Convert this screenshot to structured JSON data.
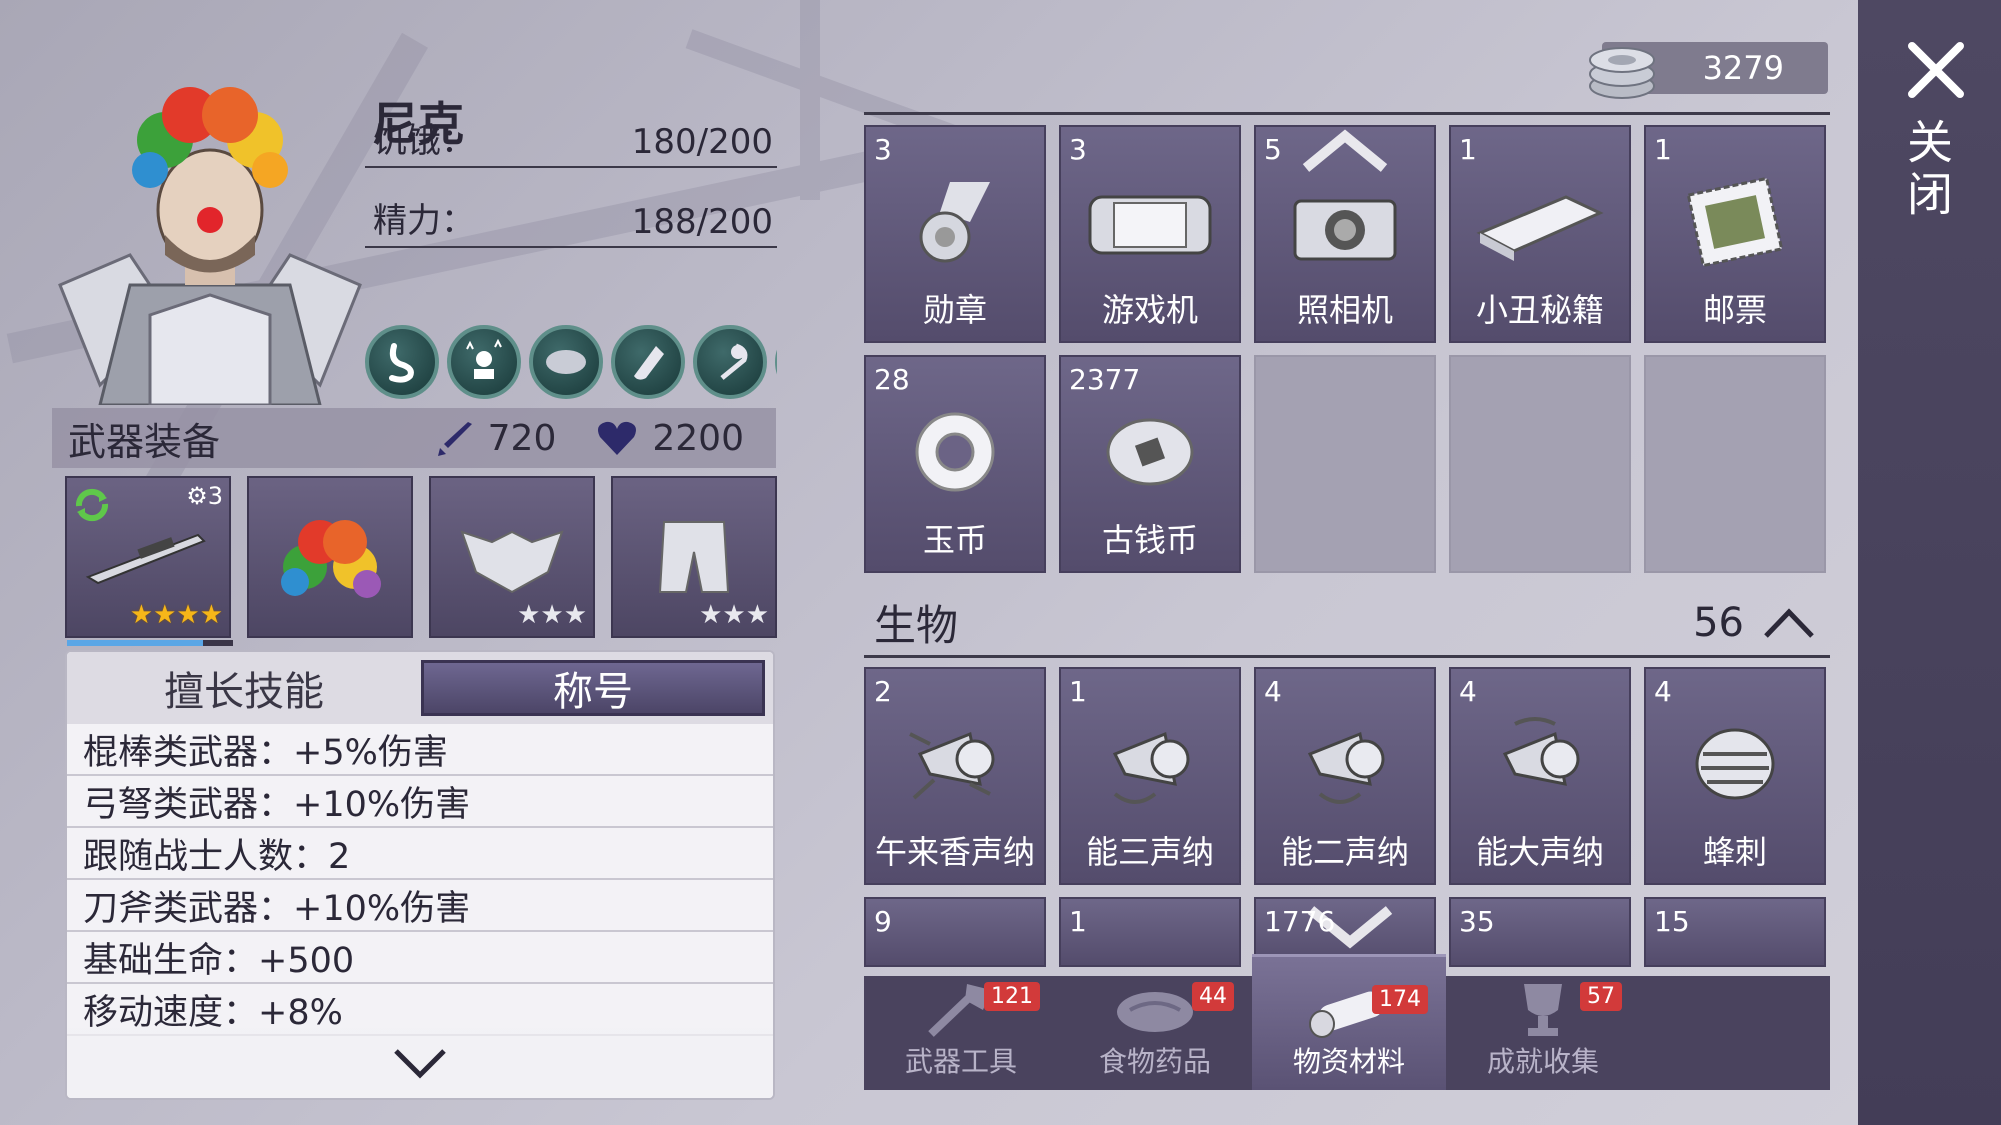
{
  "character": {
    "name": "尼克",
    "hunger_label": "饥饿：",
    "hunger_value": "180/200",
    "energy_label": "精力：",
    "energy_value": "188/200"
  },
  "equipment": {
    "title": "武器装备",
    "attack": "720",
    "health": "2200",
    "weapon_level": "3",
    "slots": [
      {
        "name": "sniper-rifle",
        "stars": 4,
        "star_type": "gold"
      },
      {
        "name": "rainbow-wig",
        "stars": 0,
        "star_type": "none"
      },
      {
        "name": "spiked-armor",
        "stars": 3,
        "star_type": "silver"
      },
      {
        "name": "armored-pants",
        "stars": 3,
        "star_type": "silver"
      }
    ],
    "weapon_xp_fraction": 0.82
  },
  "skills": {
    "tab_skills": "擅长技能",
    "tab_title": "称号",
    "rows": [
      "棍棒类武器：+5%伤害",
      "弓弩类武器：+10%伤害",
      "跟随战士人数：2",
      "刀斧类武器：+10%伤害",
      "基础生命：+500",
      "移动速度：+8%"
    ]
  },
  "currency": {
    "coins": "3279"
  },
  "inventory": {
    "top_items": [
      {
        "count": "3",
        "name": "勋章",
        "icon": "medal-icon"
      },
      {
        "count": "3",
        "name": "游戏机",
        "icon": "game-console-icon"
      },
      {
        "count": "5",
        "name": "照相机",
        "icon": "camera-icon"
      },
      {
        "count": "1",
        "name": "小丑秘籍",
        "icon": "book-icon"
      },
      {
        "count": "1",
        "name": "邮票",
        "icon": "stamp-icon"
      },
      {
        "count": "28",
        "name": "玉币",
        "icon": "jade-coin-icon"
      },
      {
        "count": "2377",
        "name": "古钱币",
        "icon": "ancient-coin-icon"
      }
    ],
    "section_title": "生物",
    "section_count": "56",
    "bio_items": [
      {
        "count": "2",
        "name": "午来香声纳",
        "icon": "sonar-icon"
      },
      {
        "count": "1",
        "name": "能三声纳",
        "icon": "sonar-icon"
      },
      {
        "count": "4",
        "name": "能二声纳",
        "icon": "sonar-icon"
      },
      {
        "count": "4",
        "name": "能大声纳",
        "icon": "sonar-icon"
      },
      {
        "count": "4",
        "name": "蜂刺",
        "icon": "bee-sting-icon"
      }
    ],
    "bio_items_row2": [
      {
        "count": "9"
      },
      {
        "count": "1"
      },
      {
        "count": "1776"
      },
      {
        "count": "35"
      },
      {
        "count": "15"
      }
    ]
  },
  "tabs": [
    {
      "label": "武器工具",
      "badge": "121",
      "icon": "axe-icon"
    },
    {
      "label": "食物药品",
      "badge": "44",
      "icon": "meat-icon"
    },
    {
      "label": "物资材料",
      "badge": "174",
      "icon": "wood-log-icon",
      "active": true
    },
    {
      "label": "成就收集",
      "badge": "57",
      "icon": "trophy-icon"
    }
  ],
  "close": {
    "label": "关闭"
  },
  "colors": {
    "accent": "#5a5274",
    "badge": "#d23a3a",
    "star_gold": "#f6b619"
  }
}
